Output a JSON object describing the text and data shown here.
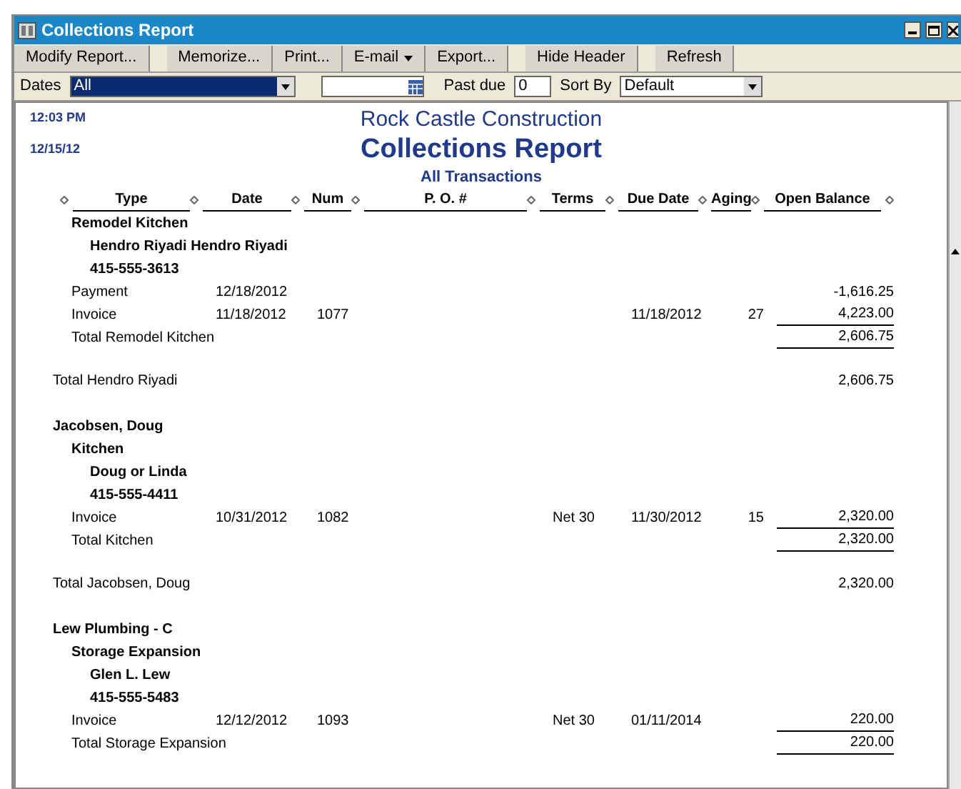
{
  "window": {
    "title": "Collections Report"
  },
  "toolbar": [
    {
      "label": "Modify Report...",
      "kind": "button"
    },
    {
      "label": "Memorize...",
      "kind": "button"
    },
    {
      "label": "Print...",
      "kind": "button"
    },
    {
      "label": "E-mail",
      "kind": "menu"
    },
    {
      "label": "Export...",
      "kind": "button"
    },
    {
      "label": "Hide Header",
      "kind": "button"
    },
    {
      "label": "Refresh",
      "kind": "button"
    }
  ],
  "filters": {
    "dates_label": "Dates",
    "dates_value": "All",
    "past_due_label": "Past due",
    "past_due_value": "0",
    "sort_label": "Sort By",
    "sort_value": "Default"
  },
  "report": {
    "time": "12:03 PM",
    "date": "12/15/12",
    "company": "Rock Castle Construction",
    "title": "Collections Report",
    "subtitle": "All Transactions",
    "columns": [
      "Type",
      "Date",
      "Num",
      "P. O. #",
      "Terms",
      "Due Date",
      "Aging",
      "Open Balance"
    ],
    "customers": [
      {
        "jobs": [
          {
            "label": "Remodel Kitchen",
            "contact": "Hendro Riyadi Hendro Riyadi",
            "phone": "415-555-3613",
            "transactions": [
              {
                "type": "Payment",
                "date": "12/18/2012",
                "amount": "-1,616.25"
              },
              {
                "type": "Invoice",
                "date": "11/18/2012",
                "num": "1077",
                "due": "11/18/2012",
                "aging": "27",
                "amount": "4,223.00"
              }
            ],
            "total_label": "Total Remodel Kitchen",
            "total": "2,606.75"
          }
        ],
        "total_label": "Total Hendro Riyadi",
        "total": "2,606.75"
      },
      {
        "label": "Jacobsen, Doug",
        "jobs": [
          {
            "label": "Kitchen",
            "contact": "Doug or Linda",
            "phone": "415-555-4411",
            "transactions": [
              {
                "type": "Invoice",
                "date": "10/31/2012",
                "num": "1082",
                "terms": "Net 30",
                "due": "11/30/2012",
                "aging": "15",
                "amount": "2,320.00"
              }
            ],
            "total_label": "Total Kitchen",
            "total": "2,320.00"
          }
        ],
        "total_label": "Total Jacobsen, Doug",
        "total": "2,320.00"
      },
      {
        "label": "Lew Plumbing - C",
        "jobs": [
          {
            "label": "Storage Expansion",
            "contact": "Glen L. Lew",
            "phone": "415-555-5483",
            "transactions": [
              {
                "type": "Invoice",
                "date": "12/12/2012",
                "num": "1093",
                "terms": "Net 30",
                "due": "01/11/2014",
                "amount": "220.00"
              }
            ],
            "total_label": "Total Storage Expansion",
            "total": "220.00"
          }
        ]
      }
    ]
  }
}
